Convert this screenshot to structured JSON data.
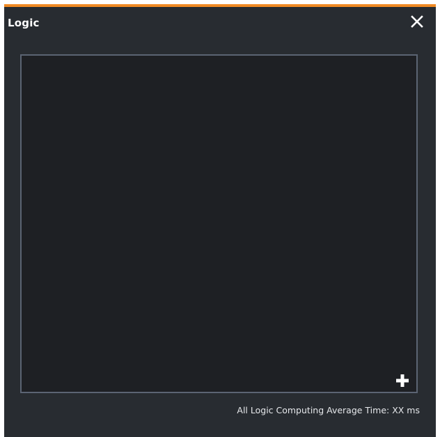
{
  "window": {
    "title": "Logic",
    "accent_color": "#f08a24",
    "background_color": "#282c31",
    "close_icon": "close-icon"
  },
  "canvas": {
    "background_color": "#1e2024",
    "border_color": "#5b6473",
    "add_icon": "plus-icon"
  },
  "footer": {
    "status_text": "All Logic Computing Average Time: XX ms"
  }
}
